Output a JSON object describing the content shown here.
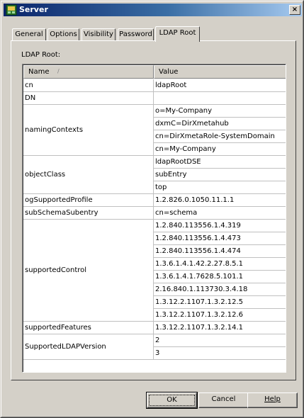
{
  "window": {
    "title": "Server",
    "close_glyph": "×"
  },
  "tabs": [
    {
      "label": "General",
      "active": false
    },
    {
      "label": "Options",
      "active": false
    },
    {
      "label": "Visibility",
      "active": false
    },
    {
      "label": "Password",
      "active": false
    },
    {
      "label": "LDAP Root",
      "active": true
    }
  ],
  "panel": {
    "label": "LDAP Root:"
  },
  "grid": {
    "columns": [
      "Name",
      "Value"
    ],
    "sort_icon": "arrow-up-icon",
    "rows": [
      {
        "name": "cn",
        "values": [
          "ldapRoot"
        ]
      },
      {
        "name": "DN",
        "values": [
          ""
        ]
      },
      {
        "name": "namingContexts",
        "values": [
          "o=My-Company",
          "dxmC=DirXmetahub",
          "cn=DirXmetaRole-SystemDomain",
          "cn=My-Company"
        ]
      },
      {
        "name": "objectClass",
        "values": [
          "ldapRootDSE",
          "subEntry",
          "top"
        ]
      },
      {
        "name": "ogSupportedProfile",
        "values": [
          "1.2.826.0.1050.11.1.1"
        ]
      },
      {
        "name": "subSchemaSubentry",
        "values": [
          "cn=schema"
        ]
      },
      {
        "name": "supportedControl",
        "values": [
          "1.2.840.113556.1.4.319",
          "1.2.840.113556.1.4.473",
          "1.2.840.113556.1.4.474",
          "1.3.6.1.4.1.42.2.27.8.5.1",
          "1.3.6.1.4.1.7628.5.101.1",
          "2.16.840.1.113730.3.4.18",
          "1.3.12.2.1107.1.3.2.12.5",
          "1.3.12.2.1107.1.3.2.12.6"
        ]
      },
      {
        "name": "supportedFeatures",
        "values": [
          "1.3.12.2.1107.1.3.2.14.1"
        ]
      },
      {
        "name": "SupportedLDAPVersion",
        "values": [
          "2",
          "3"
        ]
      }
    ]
  },
  "buttons": {
    "ok": "OK",
    "cancel": "Cancel",
    "help": "Help"
  }
}
